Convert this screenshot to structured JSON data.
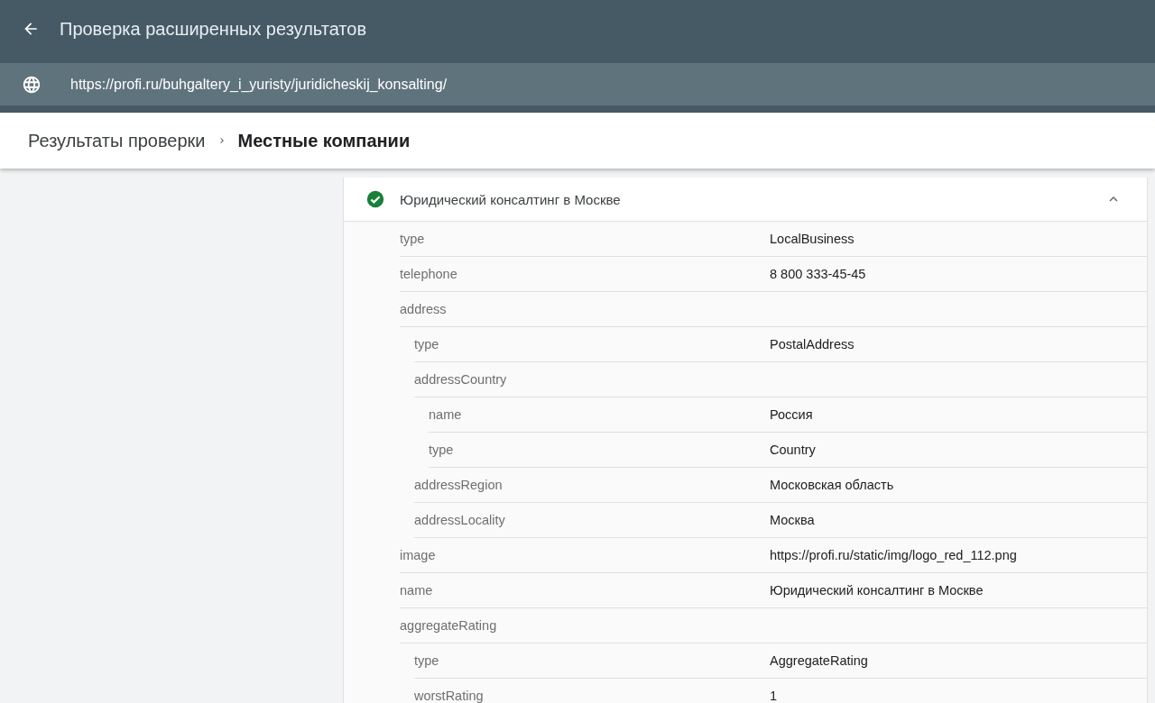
{
  "header": {
    "title": "Проверка расширенных результатов",
    "url": "https://profi.ru/buhgaltery_i_yuristy/juridicheskij_konsalting/"
  },
  "breadcrumb": [
    {
      "label": "Результаты проверки",
      "selected": false
    },
    {
      "label": "Местные компании",
      "selected": true
    }
  ],
  "item": {
    "title": "Юридический консалтинг в Москве",
    "valid": true,
    "expanded": true,
    "fields": [
      {
        "name": "type",
        "value": "LocalBusiness"
      },
      {
        "name": "telephone",
        "value": "8 800 333-45-45"
      },
      {
        "name": "address",
        "children": [
          {
            "name": "type",
            "value": "PostalAddress"
          },
          {
            "name": "addressCountry",
            "children": [
              {
                "name": "name",
                "value": "Россия"
              },
              {
                "name": "type",
                "value": "Country"
              }
            ]
          },
          {
            "name": "addressRegion",
            "value": "Московская область"
          },
          {
            "name": "addressLocality",
            "value": "Москва"
          }
        ]
      },
      {
        "name": "image",
        "value": "https://profi.ru/static/img/logo_red_112.png"
      },
      {
        "name": "name",
        "value": "Юридический консалтинг в Москве"
      },
      {
        "name": "aggregateRating",
        "children": [
          {
            "name": "type",
            "value": "AggregateRating"
          },
          {
            "name": "worstRating",
            "value": "1"
          }
        ]
      }
    ]
  }
}
